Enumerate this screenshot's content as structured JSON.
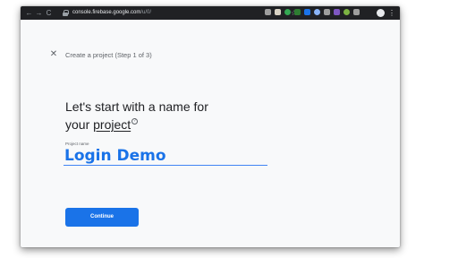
{
  "browser": {
    "back_icon": "←",
    "forward_icon": "→",
    "reload_icon": "C",
    "url_host": "console.firebase.google.com",
    "url_path": "/u/0/",
    "star_icon": "☆",
    "menu_icon": "⋮",
    "extension_colors": [
      "#9e9e9e",
      "#d8d2c4",
      "#34a853",
      "#2e7d32",
      "#1a73e8",
      "#8ab4f8",
      "#9e9e9e",
      "#7e57c2",
      "#7cb342",
      "#9e9e9e"
    ]
  },
  "page": {
    "close_icon": "✕",
    "step_title": "Create a project (Step 1 of 3)",
    "headline_part1": "Let's start with a name for",
    "headline_part2": "your ",
    "headline_link": "project",
    "help_icon_glyph": "?",
    "field_label": "Project name",
    "project_name_value": "Login Demo",
    "continue_label": "Continue"
  },
  "colors": {
    "accent": "#1a73e8",
    "toolbar": "#202124",
    "page_background": "#f8f9fa"
  }
}
